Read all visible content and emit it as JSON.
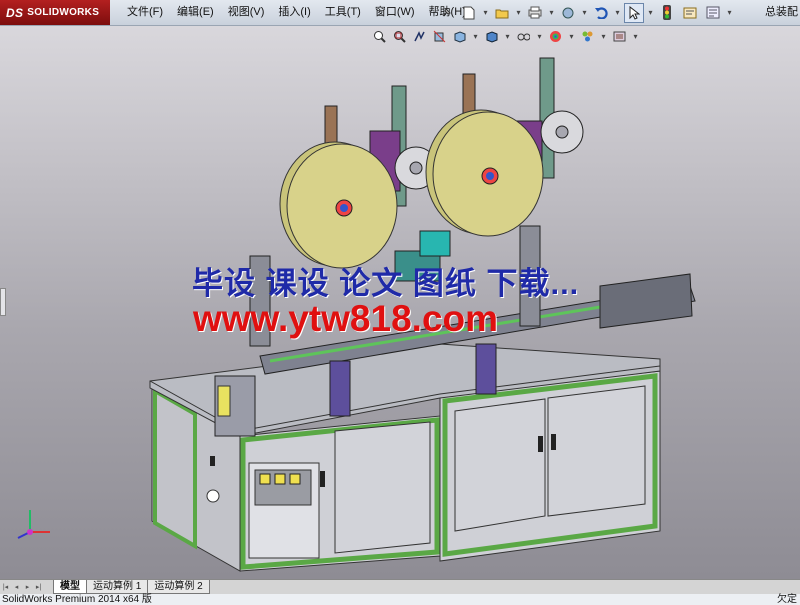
{
  "app": {
    "logo_text": "SOLIDWORKS",
    "logo_mark": "DS",
    "right_title": "总装配"
  },
  "menu": [
    {
      "label": "文件(F)"
    },
    {
      "label": "编辑(E)"
    },
    {
      "label": "视图(V)"
    },
    {
      "label": "插入(I)"
    },
    {
      "label": "工具(T)"
    },
    {
      "label": "窗口(W)"
    },
    {
      "label": "帮助(H)"
    }
  ],
  "toolbar_icons": [
    "pin-icon",
    "new-document-icon",
    "open-folder-icon",
    "print-icon",
    "print-options-icon",
    "undo-icon",
    "select-pointer-icon",
    "traffic-light-icon",
    "file-properties-icon",
    "options-icon"
  ],
  "hud_icons": [
    "zoom-to-fit-icon",
    "zoom-to-area-icon",
    "previous-view-icon",
    "section-view-icon",
    "view-orientation-icon",
    "display-style-icon",
    "hide-show-icon",
    "edit-appearance-icon",
    "apply-scene-icon",
    "view-settings-icon"
  ],
  "watermark": {
    "line1": "毕设 课设 论文 图纸 下载...",
    "line2": "www.ytw818.com"
  },
  "tabs": [
    {
      "label": "模型",
      "active": true
    },
    {
      "label": "运动算例 1",
      "active": false
    },
    {
      "label": "运动算例 2",
      "active": false
    }
  ],
  "status": {
    "left": "SolidWorks Premium 2014 x64 版",
    "right": "欠定"
  },
  "colors": {
    "viewport_top": "#d9d7dc",
    "viewport_bottom": "#8e8c94",
    "frame_green": "#5aa845",
    "reel_yellow": "#d8d28a",
    "watermark_blue": "#1f2aa8",
    "watermark_red": "#e01010"
  }
}
